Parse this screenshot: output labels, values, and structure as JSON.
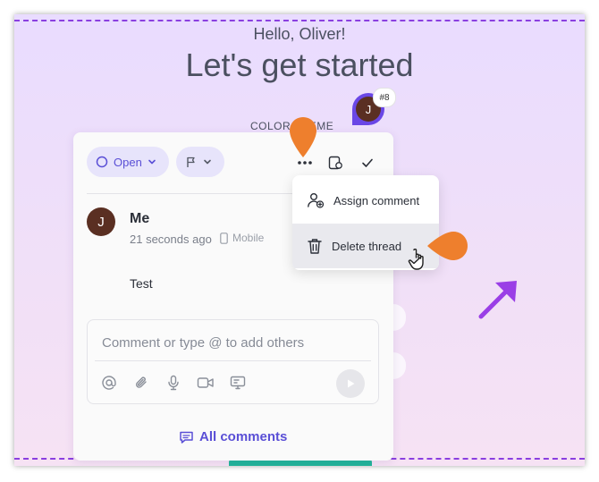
{
  "background": {
    "greeting": "Hello, Oliver!",
    "title": "Let's get started",
    "color_theme_label": "COLOR THEME"
  },
  "pin": {
    "avatar_initial": "J",
    "badge": "#8"
  },
  "panel": {
    "status_label": "Open",
    "comment": {
      "author_initial": "J",
      "author": "Me",
      "time": "21 seconds ago",
      "device": "Mobile",
      "text": "Test"
    },
    "input_placeholder": "Comment or type @ to add others",
    "all_comments_label": "All comments"
  },
  "menu": {
    "items": [
      {
        "label": "Assign comment",
        "icon": "assign-user-icon"
      },
      {
        "label": "Delete thread",
        "icon": "trash-icon"
      }
    ]
  },
  "colors": {
    "accent": "#5a4fd6",
    "marker": "#ee7f2d",
    "pin": "#6a47e6",
    "arrow": "#9a3fe6"
  }
}
